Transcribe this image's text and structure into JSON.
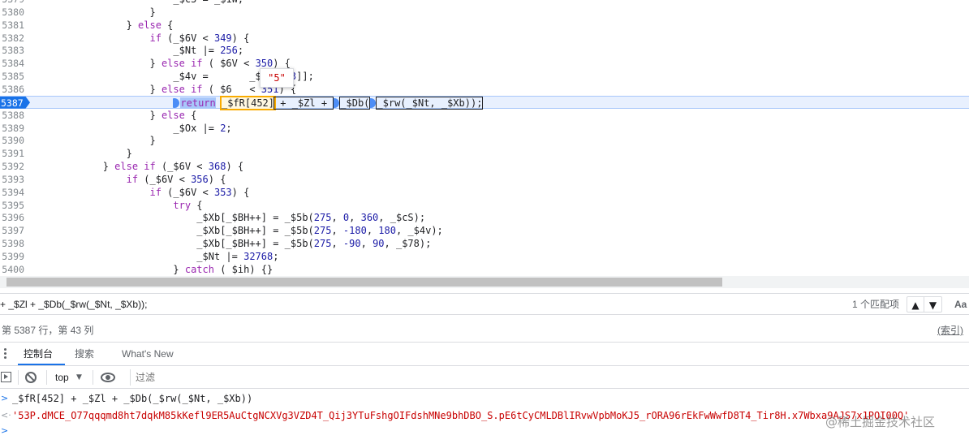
{
  "editor": {
    "lines": [
      {
        "n": "5379",
        "segs": [
          [
            "",
            "                        "
          ],
          [
            "",
            "_$c5 = _$1W;"
          ]
        ]
      },
      {
        "n": "5380",
        "segs": [
          [
            "",
            "                    }"
          ]
        ]
      },
      {
        "n": "5381",
        "segs": [
          [
            "",
            "                } "
          ],
          [
            "kw",
            "else"
          ],
          [
            "",
            " {"
          ]
        ]
      },
      {
        "n": "5382",
        "segs": [
          [
            "",
            "                    "
          ],
          [
            "kw",
            "if"
          ],
          [
            "",
            " (_$6V < "
          ],
          [
            "num",
            "349"
          ],
          [
            "",
            ") {"
          ]
        ]
      },
      {
        "n": "5383",
        "segs": [
          [
            "",
            "                        _$Nt |= "
          ],
          [
            "num",
            "256"
          ],
          [
            "",
            ";"
          ]
        ]
      },
      {
        "n": "5384",
        "segs": [
          [
            "",
            "                    } "
          ],
          [
            "kw",
            "else if"
          ],
          [
            "",
            " ( $6V < "
          ],
          [
            "num",
            "350"
          ],
          [
            "",
            ") {"
          ]
        ]
      },
      {
        "n": "5385",
        "segs": [
          [
            "",
            "                        _$4v =       _$fR["
          ],
          [
            "num",
            "333"
          ],
          [
            "",
            "]];"
          ]
        ]
      },
      {
        "n": "5386",
        "segs": [
          [
            "",
            "                    } "
          ],
          [
            "kw",
            "else if"
          ],
          [
            "",
            " ( $6   < "
          ],
          [
            "num",
            "351"
          ],
          [
            "",
            ") {"
          ]
        ]
      },
      {
        "n": "5387",
        "active": true
      },
      {
        "n": "5388",
        "segs": [
          [
            "",
            "                    } "
          ],
          [
            "kw",
            "else"
          ],
          [
            "",
            " {"
          ]
        ]
      },
      {
        "n": "5389",
        "segs": [
          [
            "",
            "                        _$Ox |= "
          ],
          [
            "num",
            "2"
          ],
          [
            "",
            ";"
          ]
        ]
      },
      {
        "n": "5390",
        "segs": [
          [
            "",
            "                    }"
          ]
        ]
      },
      {
        "n": "5391",
        "segs": [
          [
            "",
            "                }"
          ]
        ]
      },
      {
        "n": "5392",
        "segs": [
          [
            "",
            "            } "
          ],
          [
            "kw",
            "else if"
          ],
          [
            "",
            " (_$6V < "
          ],
          [
            "num",
            "368"
          ],
          [
            "",
            ") {"
          ]
        ]
      },
      {
        "n": "5393",
        "segs": [
          [
            "",
            "                "
          ],
          [
            "kw",
            "if"
          ],
          [
            "",
            " (_$6V < "
          ],
          [
            "num",
            "356"
          ],
          [
            "",
            ") {"
          ]
        ]
      },
      {
        "n": "5394",
        "segs": [
          [
            "",
            "                    "
          ],
          [
            "kw",
            "if"
          ],
          [
            "",
            " (_$6V < "
          ],
          [
            "num",
            "353"
          ],
          [
            "",
            ") {"
          ]
        ]
      },
      {
        "n": "5395",
        "segs": [
          [
            "",
            "                        "
          ],
          [
            "kw",
            "try"
          ],
          [
            "",
            " {"
          ]
        ]
      },
      {
        "n": "5396",
        "segs": [
          [
            "",
            "                            _$Xb[_$BH++] = _$5b("
          ],
          [
            "num",
            "275"
          ],
          [
            "",
            ", "
          ],
          [
            "num",
            "0"
          ],
          [
            "",
            ", "
          ],
          [
            "num",
            "360"
          ],
          [
            "",
            ", _$cS);"
          ]
        ]
      },
      {
        "n": "5397",
        "segs": [
          [
            "",
            "                            _$Xb[_$BH++] = _$5b("
          ],
          [
            "num",
            "275"
          ],
          [
            "",
            ", "
          ],
          [
            "num",
            "-180"
          ],
          [
            "",
            ", "
          ],
          [
            "num",
            "180"
          ],
          [
            "",
            ", _$4v);"
          ]
        ]
      },
      {
        "n": "5398",
        "segs": [
          [
            "",
            "                            _$Xb[_$BH++] = _$5b("
          ],
          [
            "num",
            "275"
          ],
          [
            "",
            ", "
          ],
          [
            "num",
            "-90"
          ],
          [
            "",
            ", "
          ],
          [
            "num",
            "90"
          ],
          [
            "",
            ", _$78);"
          ]
        ]
      },
      {
        "n": "5399",
        "segs": [
          [
            "",
            "                            _$Nt |= "
          ],
          [
            "num",
            "32768"
          ],
          [
            "",
            ";"
          ]
        ]
      },
      {
        "n": "5400",
        "segs": [
          [
            "",
            "                        } "
          ],
          [
            "kw",
            "catch"
          ],
          [
            "",
            " ( $ih) {}"
          ]
        ]
      }
    ],
    "active_line": {
      "indent": "                        ",
      "keyword": "return",
      "fr_expr": "_$fR[452]",
      "rest1": " + _$Zl + ",
      "db_call": "_$Db(",
      "rw_call": "_$rw(_$Nt, _$Xb));"
    },
    "tooltip_value": "\"5\""
  },
  "search": {
    "query": "+ _$Zl + _$Db(_$rw(_$Nt, _$Xb));",
    "match_count": "1 个匹配项",
    "prev_icon": "▲",
    "next_icon": "▼",
    "match_case_label": "Aa"
  },
  "status": {
    "cursor_position": "第 5387 行，第 43 列",
    "source_map": "(索引)"
  },
  "drawer": {
    "tabs": [
      "控制台",
      "搜索",
      "What's New"
    ]
  },
  "console": {
    "context": "top",
    "context_arrow": "▼",
    "filter_placeholder": "过滤",
    "input_prompt": ">",
    "command": "_$fR[452] + _$Zl + _$Db(_$rw(_$Nt, _$Xb))",
    "result_prompt": "<·",
    "result": "'53P.dMCE_O77qqqmd8ht7dqkM85kKefl9ER5AuCtgNCXVg3VZD4T_Qij3YTuFshgOIFdshMNe9bhDBO_S.pE6tCyCMLDBlIRvwVpbMoKJ5_rORA96rEkFwWwfD8T4_Tir8H.x7Wbxa9AJS7x1POI00Q'",
    "next_prompt": ">",
    "watermark": "@稀土掘金技术社区"
  }
}
